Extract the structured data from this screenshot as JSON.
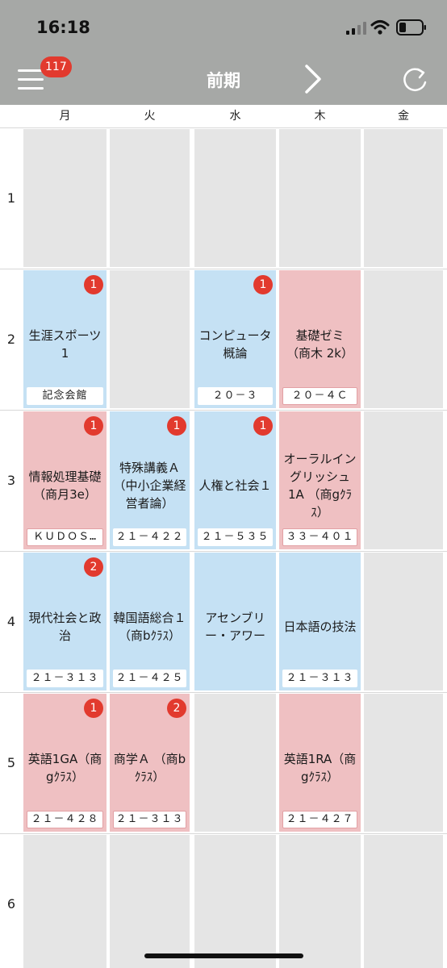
{
  "status_bar": {
    "time": "16:18"
  },
  "header": {
    "title": "前期",
    "notification_count": "117"
  },
  "days": [
    "月",
    "火",
    "水",
    "木",
    "金"
  ],
  "periods": [
    "1",
    "2",
    "3",
    "4",
    "5",
    "6"
  ],
  "colors": {
    "header_bg": "#a6a8a6",
    "badge": "#e23a2e",
    "blue_cell": "#c5e1f4",
    "pink_cell": "#efc0c2",
    "empty_cell": "#e5e5e5"
  },
  "grid": [
    [
      {
        "type": "empty"
      },
      {
        "type": "empty"
      },
      {
        "type": "empty"
      },
      {
        "type": "empty"
      },
      {
        "type": "empty"
      }
    ],
    [
      {
        "type": "blue",
        "name": "生涯スポーツ1",
        "room": "記念会館",
        "count": "1"
      },
      {
        "type": "empty"
      },
      {
        "type": "blue",
        "name": "コンピュータ概論",
        "room": "２０－３",
        "count": "1"
      },
      {
        "type": "pink",
        "name": "基礎ゼミ （商木 2k）",
        "room": "２０－４Ｃ"
      },
      {
        "type": "empty"
      }
    ],
    [
      {
        "type": "pink",
        "name": "情報処理基礎（商月3e）",
        "room": "ＫＵＤＯＳ…",
        "count": "1"
      },
      {
        "type": "blue",
        "name": "特殊講義Ａ （中小企業経営者論）",
        "room": "２１－４２２",
        "count": "1"
      },
      {
        "type": "blue",
        "name": "人権と社会１",
        "room": "２１－５３５",
        "count": "1"
      },
      {
        "type": "pink",
        "name": "オーラルイングリッシュ1A （商gｸﾗｽ）",
        "room": "３３－４０１"
      },
      {
        "type": "empty"
      }
    ],
    [
      {
        "type": "blue",
        "name": "現代社会と政治",
        "room": "２１－３１３",
        "count": "2"
      },
      {
        "type": "blue",
        "name": "韓国語総合１（商bｸﾗｽ）",
        "room": "２１－４２５"
      },
      {
        "type": "blue",
        "name": "アセンブリー・アワー"
      },
      {
        "type": "blue",
        "name": "日本語の技法",
        "room": "２１－３１３"
      },
      {
        "type": "empty"
      }
    ],
    [
      {
        "type": "pink",
        "name": "英語1GA（商gｸﾗｽ）",
        "room": "２１－４２８",
        "count": "1"
      },
      {
        "type": "pink",
        "name": "商学Ａ （商bｸﾗｽ）",
        "room": "２１－３１３",
        "count": "2"
      },
      {
        "type": "empty"
      },
      {
        "type": "pink",
        "name": "英語1RA（商gｸﾗｽ）",
        "room": "２１－４２７"
      },
      {
        "type": "empty"
      }
    ],
    [
      {
        "type": "empty"
      },
      {
        "type": "empty"
      },
      {
        "type": "empty"
      },
      {
        "type": "empty"
      },
      {
        "type": "empty"
      }
    ]
  ]
}
